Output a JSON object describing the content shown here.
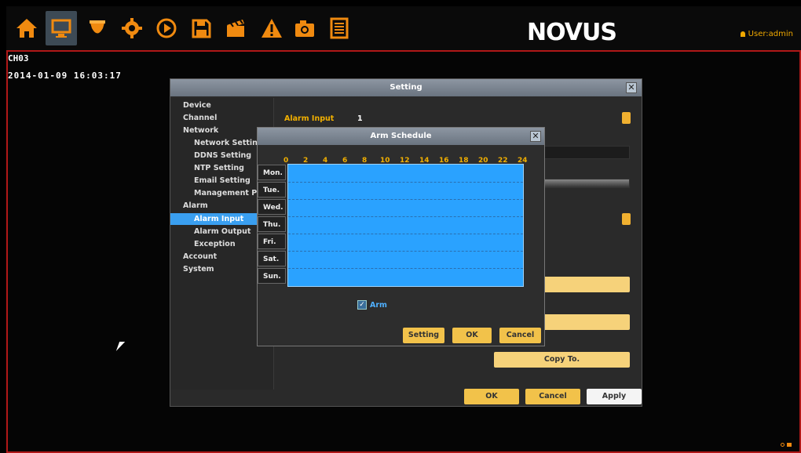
{
  "toolbar": {
    "icons": [
      "home-icon",
      "monitor-icon",
      "camera-icon",
      "gear-icon",
      "play-icon",
      "save-icon",
      "clapper-icon",
      "alarm-icon",
      "snapshot-icon",
      "log-icon"
    ],
    "active_index": 1,
    "brand": "NOVUS",
    "user_label": "User:admin"
  },
  "osd": {
    "channel": "CH03",
    "datetime": "2014-01-09 16:03:17"
  },
  "setting_dialog": {
    "title": "Setting",
    "nav": {
      "device": "Device",
      "channel": "Channel",
      "network": "Network",
      "network_setting": "Network Setting",
      "ddns_setting": "DDNS Setting",
      "ntp_setting": "NTP Setting",
      "email_setting": "Email Setting",
      "management_platform": "Management Pl",
      "alarm": "Alarm",
      "alarm_input": "Alarm Input",
      "alarm_output": "Alarm Output",
      "exception": "Exception",
      "account": "Account",
      "system": "System"
    },
    "alarm_input_label": "Alarm Input",
    "alarm_input_value": "1",
    "copy_to": "Copy To.",
    "ok": "OK",
    "cancel": "Cancel",
    "apply": "Apply"
  },
  "arm_schedule": {
    "title": "Arm Schedule",
    "hours": [
      "0",
      "2",
      "4",
      "6",
      "8",
      "10",
      "12",
      "14",
      "16",
      "18",
      "20",
      "22",
      "24"
    ],
    "days": [
      "Mon.",
      "Tue.",
      "Wed.",
      "Thu.",
      "Fri.",
      "Sat.",
      "Sun."
    ],
    "arm_label": "Arm",
    "arm_checked": true,
    "setting": "Setting",
    "ok": "OK",
    "cancel": "Cancel"
  },
  "colors": {
    "accent": "#f2b000",
    "frame_border": "#b01818",
    "schedule_fill": "#2aa2ff",
    "nav_selected": "#3a9ff0"
  }
}
